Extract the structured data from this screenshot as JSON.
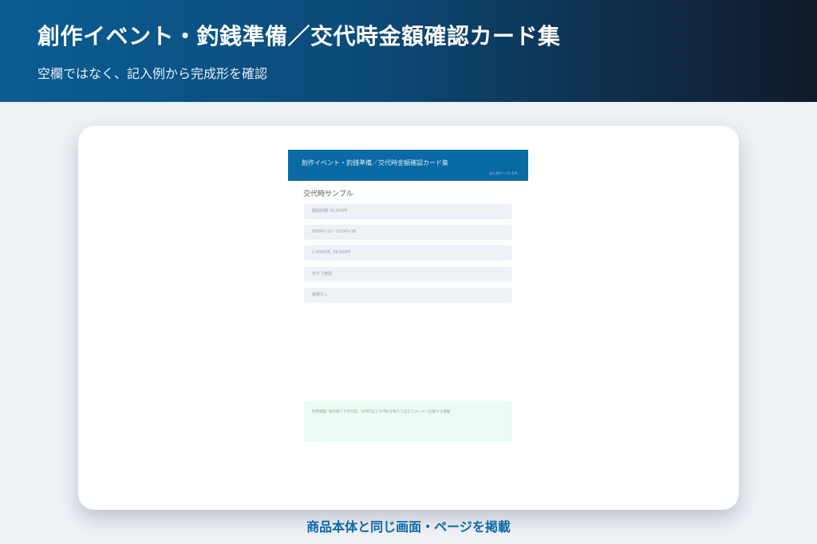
{
  "header": {
    "title": "創作イベント・釣銭準備／交代時金額確認カード集",
    "subtitle": "空欄ではなく、記入例から完成形を確認"
  },
  "preview": {
    "doc_title": "創作イベント・釣銭準備／交代時金額確認カード集",
    "doc_tag": "記入例サンプル1/4",
    "section_title": "交代時サンプル",
    "rows": [
      "開始釣銭 15,000円",
      "500円×10／100円×30",
      "1,000円札 18,500円",
      "双方で確認",
      "差額なし"
    ],
    "note": "利用場面: 昼の売り子交代前、500円玉と千円札を数えて双方でカードへ記録する場面"
  },
  "caption": "商品本体と同じ画面・ページを掲載",
  "colors": {
    "header_start": "#0a5d93",
    "header_end": "#111a2a",
    "doc_header": "#0a6aa4",
    "caption": "#0d68a6",
    "note_bg": "#ecfbf3"
  }
}
